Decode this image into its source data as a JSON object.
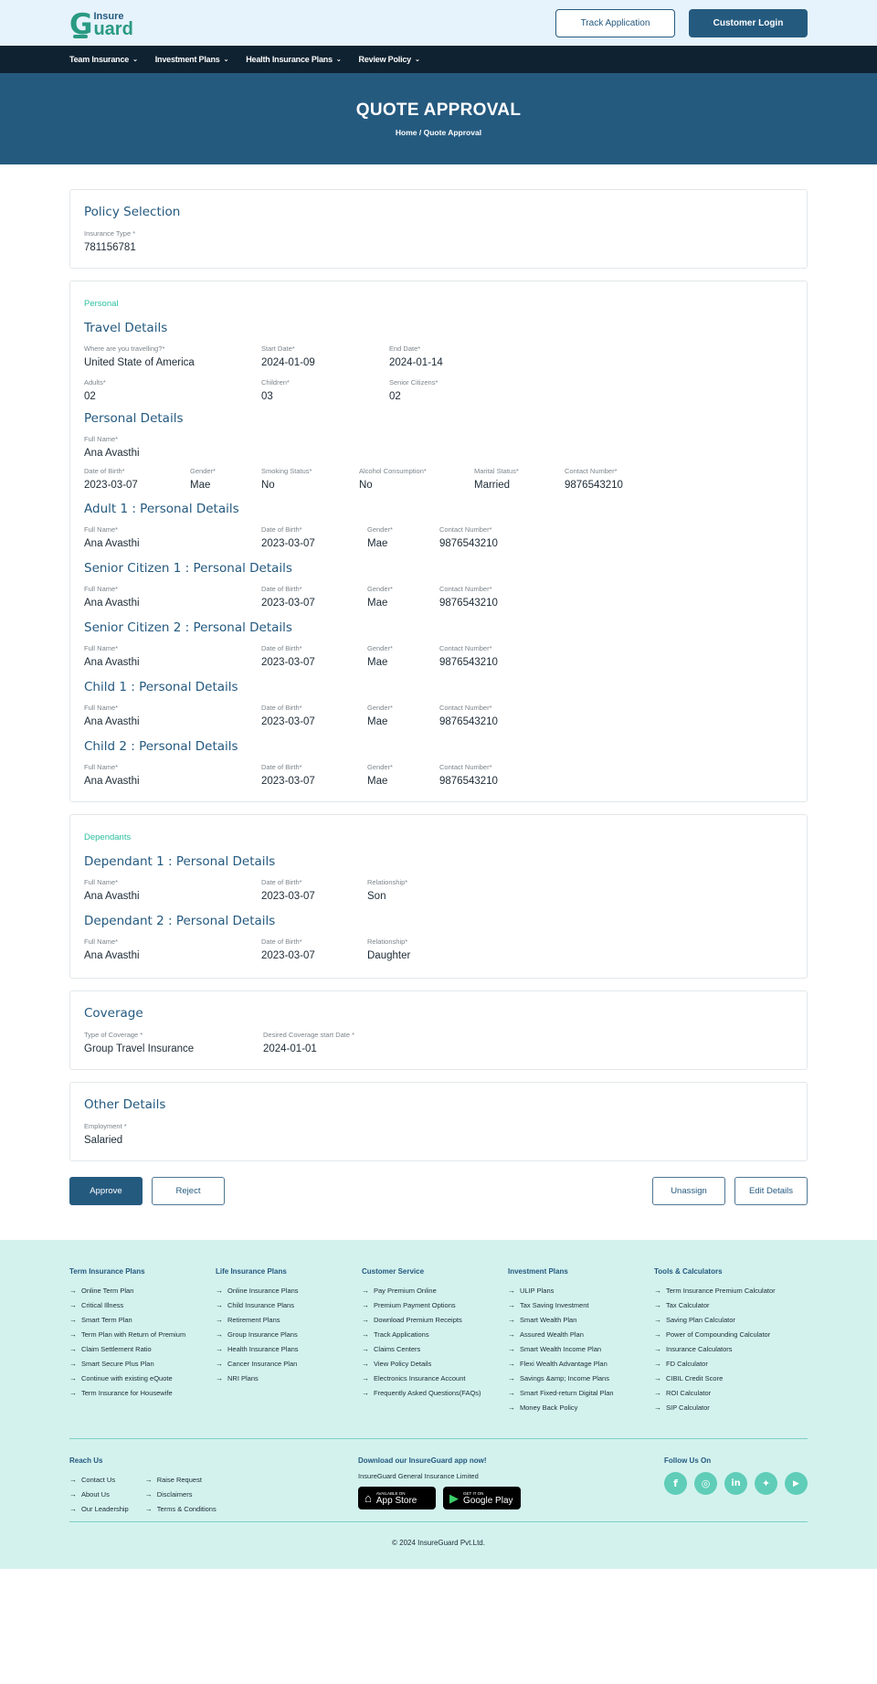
{
  "header": {
    "logo_top": "Insure",
    "logo_g": "G",
    "logo_bottom": "uard",
    "track_label": "Track Application",
    "login_label": "Customer Login"
  },
  "nav": {
    "items": [
      {
        "label": "Team Insurance"
      },
      {
        "label": "Investment Plans"
      },
      {
        "label": "Health Insurance Plans"
      },
      {
        "label": "Review Policy"
      }
    ]
  },
  "hero": {
    "title": "QUOTE APPROVAL",
    "breadcrumb": "Home  / Quote Approval"
  },
  "policy": {
    "title": "Policy Selection",
    "type_label": "Insurance Type *",
    "type_value": "781156781"
  },
  "personal": {
    "eyebrow": "Personal",
    "travel_title": "Travel Details",
    "where_label": "Where are you travelling?*",
    "where_value": "United State of America",
    "start_label": "Start Date*",
    "start_value": "2024-01-09",
    "end_label": "End Date*",
    "end_value": "2024-01-14",
    "adults_label": "Adults*",
    "adults_value": "02",
    "children_label": "Children*",
    "children_value": "03",
    "seniors_label": "Senior Citizens*",
    "seniors_value": "02",
    "pd_title": "Personal Details",
    "pd_name_label": "Full Name*",
    "pd_name_value": "Ana Avasthi",
    "pd_dob_label": "Date of Birth*",
    "pd_dob_value": "2023-03-07",
    "pd_gender_label": "Gender*",
    "pd_gender_value": "Mae",
    "pd_smoke_label": "Smoking Status*",
    "pd_smoke_value": "No",
    "pd_alcohol_label": "Alcohol Consumption*",
    "pd_alcohol_value": "No",
    "pd_marital_label": "Marital Status*",
    "pd_marital_value": "Married",
    "pd_contact_label": "Contact Number*",
    "pd_contact_value": "9876543210",
    "members": [
      {
        "title": "Adult 1 : Personal Details",
        "name_label": "Full Name*",
        "name": "Ana Avasthi",
        "dob_label": "Date of Birth*",
        "dob": "2023-03-07",
        "gender_label": "Gender*",
        "gender": "Mae",
        "contact_label": "Contact Number*",
        "contact": "9876543210"
      },
      {
        "title": "Senior Citizen 1 : Personal Details",
        "name_label": "Full Name*",
        "name": "Ana Avasthi",
        "dob_label": "Date of Birth*",
        "dob": "2023-03-07",
        "gender_label": "Gender*",
        "gender": "Mae",
        "contact_label": "Contact Number*",
        "contact": "9876543210"
      },
      {
        "title": "Senior Citizen 2 : Personal Details",
        "name_label": "Full Name*",
        "name": "Ana Avasthi",
        "dob_label": "Date of Birth*",
        "dob": "2023-03-07",
        "gender_label": "Gender*",
        "gender": "Mae",
        "contact_label": "Contact Number*",
        "contact": "9876543210"
      },
      {
        "title": "Child 1 : Personal Details",
        "name_label": "Full Name*",
        "name": "Ana Avasthi",
        "dob_label": "Date of Birth*",
        "dob": "2023-03-07",
        "gender_label": "Gender*",
        "gender": "Mae",
        "contact_label": "Contact Number*",
        "contact": "9876543210"
      },
      {
        "title": "Child 2 : Personal Details",
        "name_label": "Full Name*",
        "name": "Ana Avasthi",
        "dob_label": "Date of Birth*",
        "dob": "2023-03-07",
        "gender_label": "Gender*",
        "gender": "Mae",
        "contact_label": "Contact Number*",
        "contact": "9876543210"
      }
    ]
  },
  "dependants": {
    "eyebrow": "Dependants",
    "items": [
      {
        "title": "Dependant 1 : Personal Details",
        "name_label": "Full Name*",
        "name": "Ana Avasthi",
        "dob_label": "Date of Birth*",
        "dob": "2023-03-07",
        "rel_label": "Relationship*",
        "rel": "Son"
      },
      {
        "title": "Dependant 2 : Personal Details",
        "name_label": "Full Name*",
        "name": "Ana Avasthi",
        "dob_label": "Date of Birth*",
        "dob": "2023-03-07",
        "rel_label": "Relationship*",
        "rel": "Daughter"
      }
    ]
  },
  "coverage": {
    "title": "Coverage",
    "type_label": "Type of Coverage *",
    "type_value": "Group Travel Insurance",
    "date_label": "Desired Coverage start Date *",
    "date_value": "2024-01-01"
  },
  "other": {
    "title": "Other Details",
    "employment_label": "Employment *",
    "employment_value": "Salaried"
  },
  "actions": {
    "approve": "Approve",
    "reject": "Reject",
    "unassign": "Unassign",
    "edit": "Edit Details"
  },
  "footer": {
    "columns": [
      {
        "title": "Term Insurance Plans",
        "links": [
          "Online Term Plan",
          "Critical Illness",
          "Smart Term Plan",
          "Term Plan with Return of Premium",
          "Claim Settlement Ratio",
          "Smart Secure Plus Plan",
          "Continue with existing eQuote",
          "Term Insurance for Housewife"
        ]
      },
      {
        "title": "Life Insurance Plans",
        "links": [
          "Online Insurance Plans",
          "Child Insurance Plans",
          "Retirement Plans",
          "Group Insurance Plans",
          "Health Insurance Plans",
          "Cancer Insurance Plan",
          "NRI Plans"
        ]
      },
      {
        "title": "Customer Service",
        "links": [
          "Pay Premium Online",
          "Premium Payment Options",
          "Download Premium Receipts",
          "Track Applications",
          "Claims Centers",
          "View Policy Details",
          "Electronics Insurance Account",
          "Frequently Asked Questions(FAQs)"
        ]
      },
      {
        "title": "Investment Plans",
        "links": [
          "ULIP Plans",
          "Tax Saving Investment",
          "Smart Wealth Plan",
          "Assured Wealth Plan",
          "Smart Wealth Income Plan",
          "Flexi Wealth Advantage Plan",
          "Savings &amp; Income Plans",
          "Smart Fixed-return Digital Plan",
          "Money Back Policy"
        ]
      },
      {
        "title": "Tools & Calculators",
        "links": [
          "Term Insurance Premium Calculator",
          "Tax Calculator",
          "Saving Plan Calculator",
          "Power of Compounding Calculator",
          "Insurance Calculators",
          "FD Calculator",
          "CIBIL Credit Score",
          "ROI Calculator",
          "SIP Calculator"
        ]
      }
    ],
    "reach_title": "Reach Us",
    "reach_left": [
      "Contact Us",
      "About Us",
      "Our Leadership"
    ],
    "reach_right": [
      "Raise Request",
      "Disclaimers",
      "Terms & Conditions"
    ],
    "app_title": "Download our InsureGuard app now!",
    "company": "InsureGuard General Insurance Limited",
    "appstore_small": "AVAILABLE ON",
    "appstore_big": "App Store",
    "play_small": "GET IT ON",
    "play_big": "Google Play",
    "follow_title": "Follow Us On",
    "socials": [
      "facebook-icon",
      "instagram-icon",
      "linkedin-icon",
      "twitter-icon",
      "youtube-icon"
    ],
    "copyright": "© 2024 InsureGuard Pvt.Ltd."
  }
}
